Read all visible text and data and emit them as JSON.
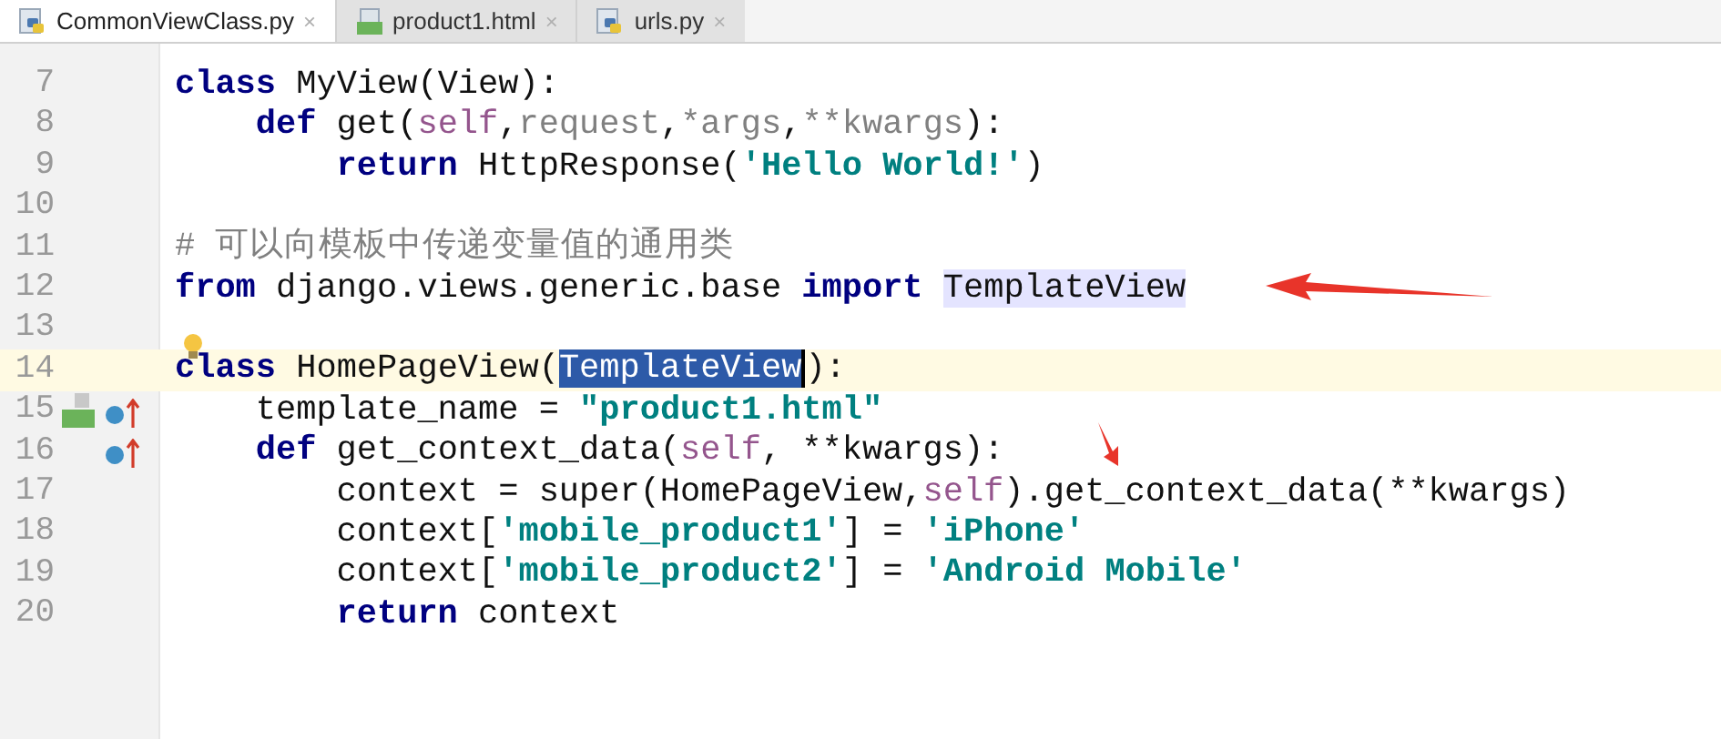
{
  "tabs": [
    {
      "label": "CommonViewClass.py",
      "close": "×",
      "selected": true,
      "kind": "python"
    },
    {
      "label": "product1.html",
      "close": "×",
      "selected": false,
      "kind": "html"
    },
    {
      "label": "urls.py",
      "close": "×",
      "selected": false,
      "kind": "python"
    }
  ],
  "editor": {
    "lines": [
      {
        "number": "7",
        "current": false,
        "segments": [
          {
            "text": "class",
            "kind": "keyword"
          },
          {
            "text": " MyView(View):",
            "kind": "plain"
          }
        ],
        "children": [
          {
            "number": "8",
            "current": false,
            "segments": [
              {
                "text": "def",
                "kind": "keyword"
              },
              {
                "text": " get(",
                "kind": "plain"
              },
              {
                "text": "self",
                "kind": "self"
              },
              {
                "text": ",",
                "kind": "plain"
              },
              {
                "text": "request",
                "kind": "unused"
              },
              {
                "text": ",",
                "kind": "plain"
              },
              {
                "text": "*args",
                "kind": "unused"
              },
              {
                "text": ",",
                "kind": "plain"
              },
              {
                "text": "**kwargs",
                "kind": "unused"
              },
              {
                "text": "):",
                "kind": "plain"
              }
            ],
            "children": [
              {
                "number": "9",
                "current": false,
                "segments": [
                  {
                    "text": "return",
                    "kind": "keyword"
                  },
                  {
                    "text": " HttpResponse(",
                    "kind": "plain"
                  },
                  {
                    "text": "'Hello World!'",
                    "kind": "string"
                  },
                  {
                    "text": ")",
                    "kind": "plain"
                  }
                ]
              }
            ]
          }
        ]
      },
      {
        "number": "10",
        "current": false
      },
      {
        "number": "11",
        "current": false,
        "segments": [
          {
            "text": "# 可以向模板中传递变量值的通用类",
            "kind": "comment"
          }
        ]
      },
      {
        "number": "12",
        "current": false,
        "segments": [
          {
            "text": "from",
            "kind": "keyword"
          },
          {
            "text": " django.views.generic.base ",
            "kind": "plain"
          },
          {
            "text": "import",
            "kind": "keyword"
          },
          {
            "text": "TemplateView",
            "kind": "usage"
          }
        ]
      },
      {
        "number": "13",
        "current": false
      },
      {
        "number": "14",
        "current": true,
        "segments": [
          {
            "text": "class",
            "kind": "keyword"
          },
          {
            "text": " HomePageView(",
            "kind": "plain"
          },
          {
            "text": "TemplateView",
            "kind": "selection"
          },
          {
            "text": "):",
            "kind": "plain"
          }
        ],
        "children": [
          {
            "number": "15",
            "current": false,
            "segments": [
              {
                "text": "template_name = ",
                "kind": "plain"
              },
              {
                "text": "\"product1.html\"",
                "kind": "string"
              }
            ]
          },
          {
            "number": "16",
            "current": false,
            "segments": [
              {
                "text": "def",
                "kind": "keyword"
              },
              {
                "text": " get_context_data(",
                "kind": "plain"
              },
              {
                "text": "self",
                "kind": "self"
              },
              {
                "text": ", **kwargs):",
                "kind": "plain"
              }
            ],
            "children": [
              {
                "number": "17",
                "current": false,
                "segments": [
                  {
                    "text": "context = super(HomePageView,",
                    "kind": "plain"
                  },
                  {
                    "text": "self",
                    "kind": "self"
                  },
                  {
                    "text": ").get_context_data(**kwargs)",
                    "kind": "plain"
                  }
                ]
              },
              {
                "number": "18",
                "current": false,
                "segments": [
                  {
                    "text": "context[",
                    "kind": "plain"
                  },
                  {
                    "text": "'mobile_product1'",
                    "kind": "string"
                  },
                  {
                    "text": "] = ",
                    "kind": "plain"
                  },
                  {
                    "text": "'iPhone'",
                    "kind": "string"
                  }
                ]
              },
              {
                "number": "19",
                "current": false,
                "segments": [
                  {
                    "text": "context[",
                    "kind": "plain"
                  },
                  {
                    "text": "'mobile_product2'",
                    "kind": "string"
                  },
                  {
                    "text": "] = ",
                    "kind": "plain"
                  },
                  {
                    "text": "'Android Mobile'",
                    "kind": "string"
                  }
                ]
              },
              {
                "number": "20",
                "current": false,
                "segments": [
                  {
                    "text": "return",
                    "kind": "keyword"
                  },
                  {
                    "text": " context",
                    "kind": "plain"
                  }
                ]
              }
            ]
          }
        ]
      }
    ]
  }
}
